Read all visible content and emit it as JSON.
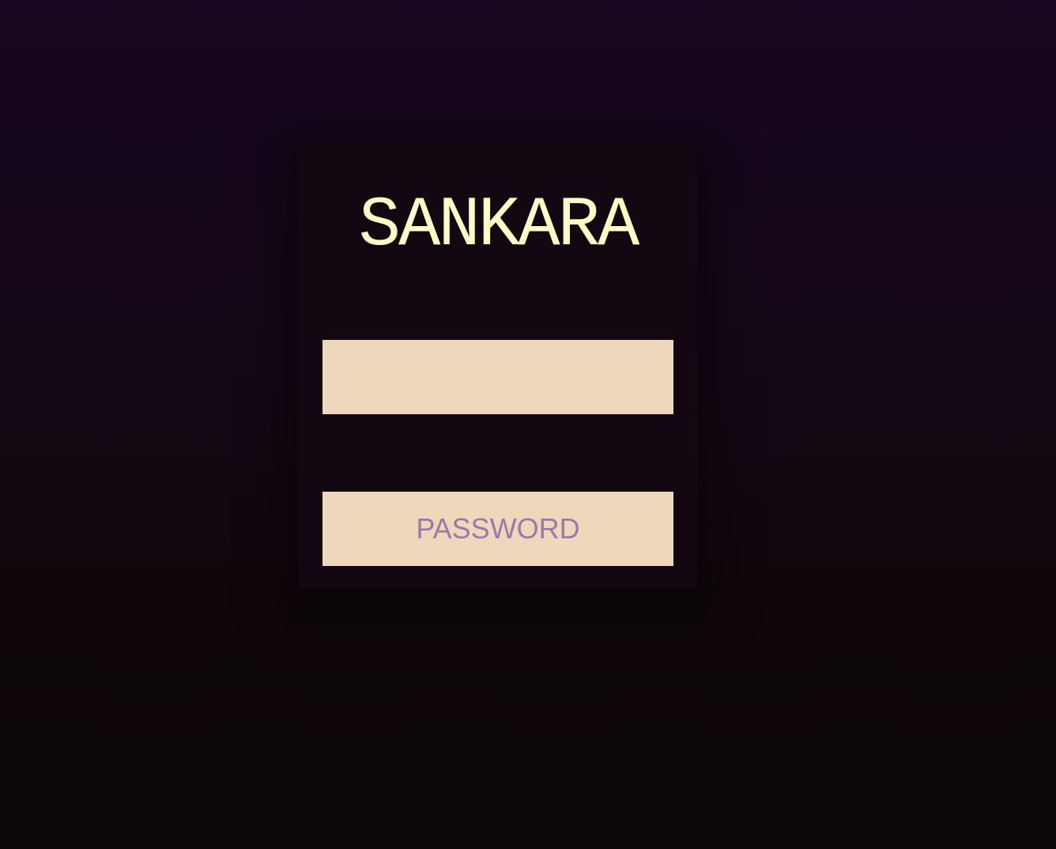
{
  "login": {
    "brand": "SANKARA",
    "username_field": {
      "value": "",
      "placeholder": ""
    },
    "password_field": {
      "value": "",
      "placeholder": "PASSWORD"
    }
  },
  "colors": {
    "brand_text": "#fffbc4",
    "field_background": "#eed8bc",
    "placeholder_text": "#9c7aa7",
    "card_background": "#130712"
  }
}
